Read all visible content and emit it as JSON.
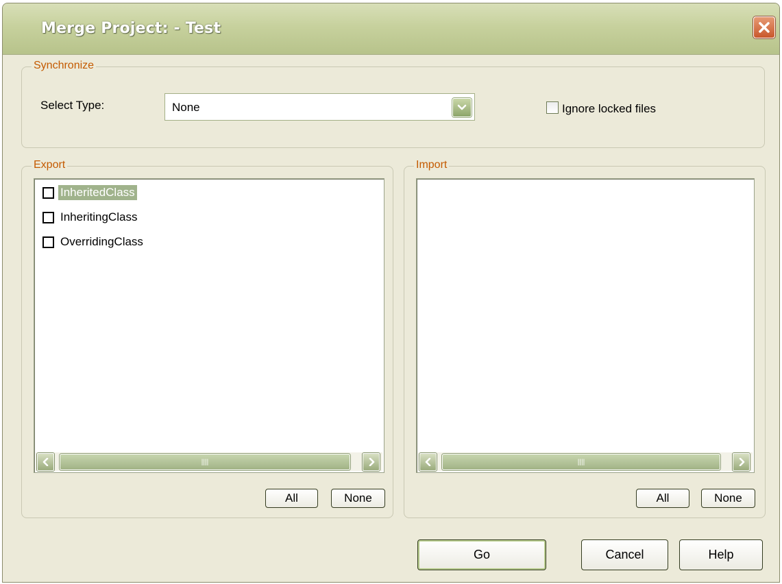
{
  "window": {
    "title": "Merge Project: - Test"
  },
  "synchronize": {
    "group_label": "Synchronize",
    "select_type_label": "Select Type:",
    "select_type_value": "None",
    "ignore_locked_label": "Ignore locked files",
    "ignore_locked_checked": false
  },
  "export": {
    "group_label": "Export",
    "items": [
      {
        "label": "InheritedClass",
        "checked": false,
        "selected": true
      },
      {
        "label": "InheritingClass",
        "checked": false,
        "selected": false
      },
      {
        "label": "OverridingClass",
        "checked": false,
        "selected": false
      }
    ],
    "all_label": "All",
    "none_label": "None"
  },
  "import": {
    "group_label": "Import",
    "items": [],
    "all_label": "All",
    "none_label": "None"
  },
  "footer": {
    "go_label": "Go",
    "cancel_label": "Cancel",
    "help_label": "Help"
  },
  "icons": {
    "close": "close-icon",
    "dropdown": "chevron-down-icon",
    "scroll_left": "arrow-left-icon",
    "scroll_right": "arrow-right-icon",
    "scroll_grip": "grip-icon"
  },
  "colors": {
    "dialog_bg": "#ecead9",
    "titlebar": "#c7d19d",
    "group_label": "#c45a00",
    "selection": "#a0b38c",
    "close_button": "#c9582c"
  }
}
